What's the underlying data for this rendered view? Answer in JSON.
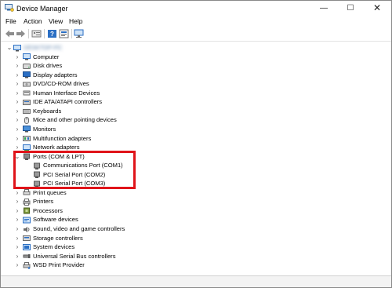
{
  "window": {
    "title": "Device Manager"
  },
  "menu": [
    {
      "label": "File",
      "x": 6
    },
    {
      "label": "Action",
      "x": 29
    },
    {
      "label": "View",
      "x": 61
    },
    {
      "label": "Help",
      "x": 87
    }
  ],
  "tree": {
    "root": "DESKTOP-PC",
    "categories": [
      "Computer",
      "Disk drives",
      "Display adapters",
      "DVD/CD-ROM drives",
      "Human Interface Devices",
      "IDE ATA/ATAPI controllers",
      "Keyboards",
      "Mice and other pointing devices",
      "Monitors",
      "Multifunction adapters",
      "Network adapters"
    ],
    "ports": {
      "label": "Ports (COM & LPT)",
      "children": [
        "Communications Port (COM1)",
        "PCI Serial Port (COM2)",
        "PCI Serial Port (COM3)"
      ]
    },
    "categories_after": [
      "Print queues",
      "Printers",
      "Processors",
      "Software devices",
      "Sound, video and game controllers",
      "Storage controllers",
      "System devices",
      "Universal Serial Bus controllers",
      "WSD Print Provider"
    ]
  },
  "colors": {
    "highlight": "#e0141a",
    "icon_blue": "#2b6fc4"
  }
}
